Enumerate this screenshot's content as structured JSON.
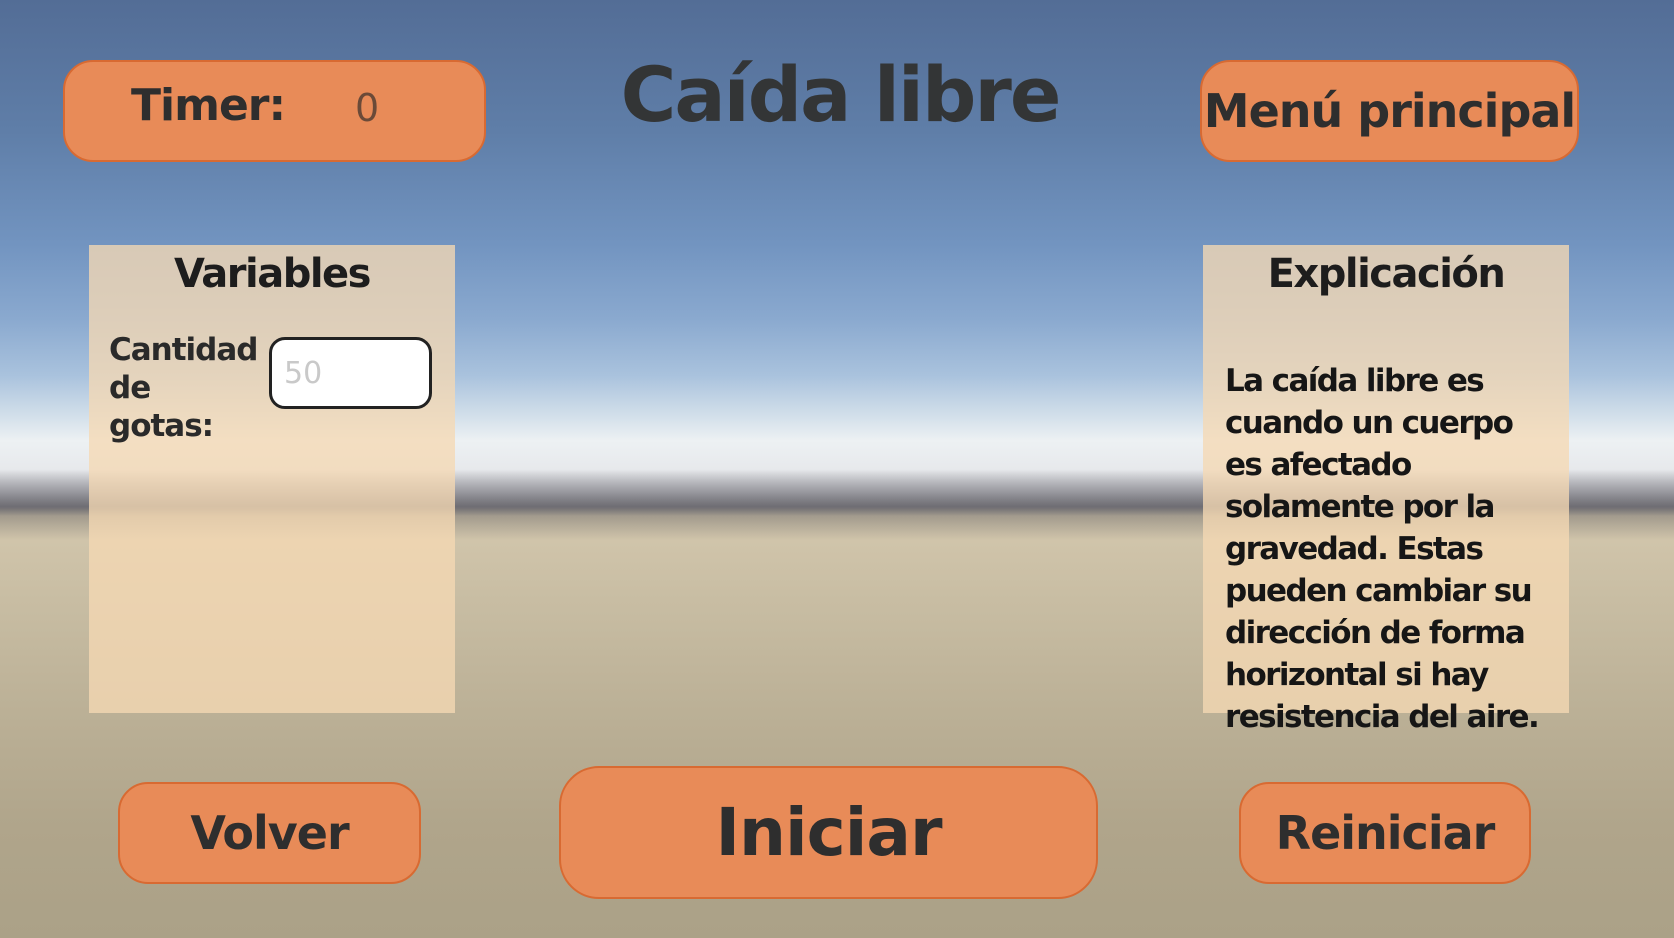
{
  "title": "Caída libre",
  "timer": {
    "label": "Timer:",
    "value": "0"
  },
  "menu_button": "Menú principal",
  "variables_panel": {
    "title": "Variables",
    "drops_label": "Cantidad de gotas:",
    "drops_placeholder": "50"
  },
  "explanation_panel": {
    "title": "Explicación",
    "text": "La caída libre es cuando un cuerpo es afectado solamente por la gravedad. Estas pueden cambiar su dirección de forma horizontal si hay resistencia del aire."
  },
  "buttons": {
    "back": "Volver",
    "start": "Iniciar",
    "restart": "Reiniciar"
  },
  "colors": {
    "button_fill": "#e88b58",
    "button_border": "#d86a32",
    "panel_fill": "#f5d8b4"
  }
}
